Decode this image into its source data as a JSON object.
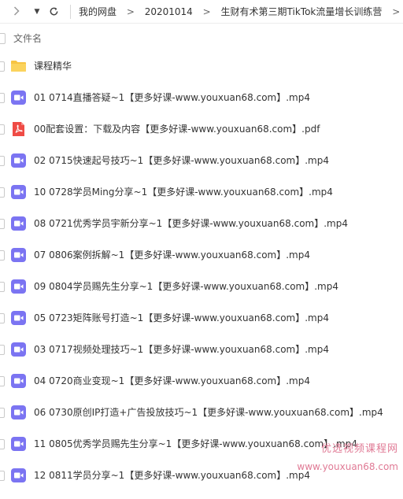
{
  "toolbar": {
    "breadcrumbs": [
      "我的网盘",
      "20201014",
      "生财有术第三期TikTok流量增长训练营"
    ],
    "separator": ">"
  },
  "list_header": {
    "name_col": "文件名"
  },
  "files": [
    {
      "name": "课程精华",
      "type": "folder"
    },
    {
      "name": "01 0714直播答疑~1【更多好课-www.youxuan68.com】.mp4",
      "type": "video"
    },
    {
      "name": "00配套设置：下载及内容【更多好课-www.youxuan68.com】.pdf",
      "type": "pdf"
    },
    {
      "name": "02 0715快速起号技巧~1【更多好课-www.youxuan68.com】.mp4",
      "type": "video"
    },
    {
      "name": "10 0728学员Ming分享~1【更多好课-www.youxuan68.com】.mp4",
      "type": "video"
    },
    {
      "name": "08 0721优秀学员宇新分享~1【更多好课-www.youxuan68.com】.mp4",
      "type": "video"
    },
    {
      "name": "07 0806案例拆解~1【更多好课-www.youxuan68.com】.mp4",
      "type": "video"
    },
    {
      "name": "09 0804学员赐先生分享~1【更多好课-www.youxuan68.com】.mp4",
      "type": "video"
    },
    {
      "name": "05 0723矩阵账号打造~1【更多好课-www.youxuan68.com】.mp4",
      "type": "video"
    },
    {
      "name": "03 0717视频处理技巧~1【更多好课-www.youxuan68.com】.mp4",
      "type": "video"
    },
    {
      "name": "04 0720商业变现~1【更多好课-www.youxuan68.com】.mp4",
      "type": "video"
    },
    {
      "name": "06 0730原创IP打造+广告投放技巧~1【更多好课-www.youxuan68.com】.mp4",
      "type": "video"
    },
    {
      "name": "11 0805优秀学员赐先生分享~1【更多好课-www.youxuan68.com】.mp4",
      "type": "video"
    },
    {
      "name": "12 0811学员分享~1【更多好课-www.youxuan68.com】.mp4",
      "type": "video"
    }
  ],
  "watermark": {
    "line1": "优选视频课程网",
    "line2": "www.youxuan68.com"
  },
  "colors": {
    "folder": "#f7c443",
    "video": "#7b74f2",
    "pdf": "#ef4b45",
    "watermark": "#e07a95"
  }
}
